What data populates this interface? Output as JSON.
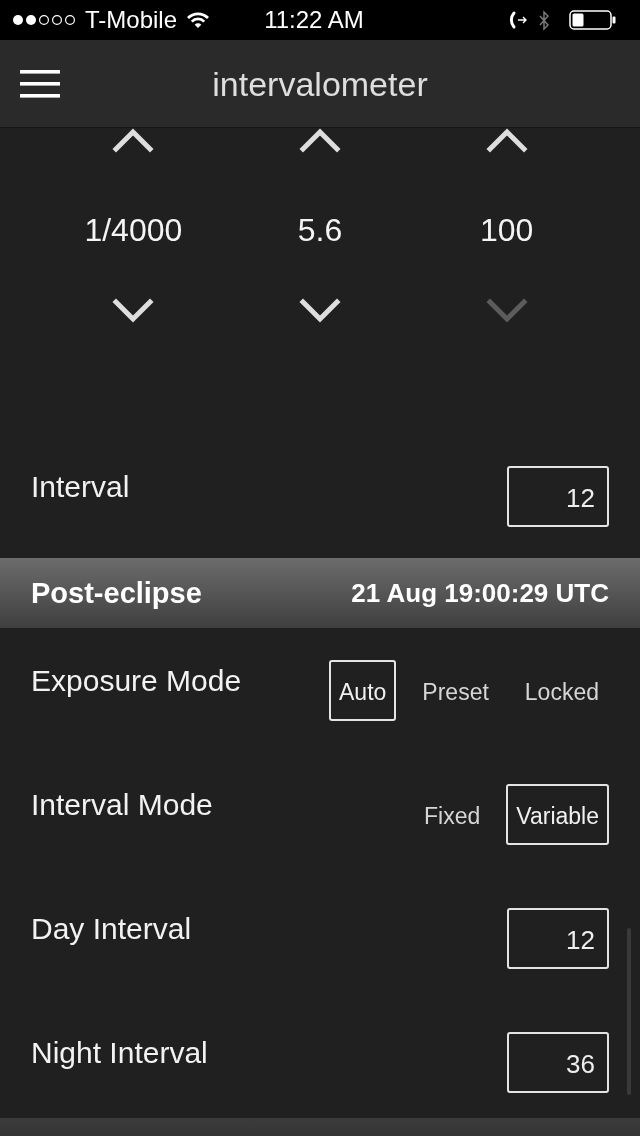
{
  "status_bar": {
    "carrier": "T-Mobile",
    "time": "11:22 AM"
  },
  "nav_bar": {
    "title": "intervalometer"
  },
  "steppers": [
    {
      "value": "1/4000",
      "up": {
        "disabled": false
      },
      "down": {
        "disabled": false
      }
    },
    {
      "value": "5.6",
      "up": {
        "disabled": false
      },
      "down": {
        "disabled": false
      }
    },
    {
      "value": "100",
      "up": {
        "disabled": false
      },
      "down": {
        "disabled": true
      }
    }
  ],
  "rows": [
    {
      "kind": "number",
      "label": "Interval",
      "value": "12"
    }
  ],
  "section": {
    "title": "Post-eclipse",
    "time": "21 Aug 19:00:29 UTC",
    "rows": [
      {
        "kind": "segmented",
        "label": "Exposure Mode",
        "options": [
          {
            "label": "Auto",
            "selected": true
          },
          {
            "label": "Preset",
            "selected": false
          },
          {
            "label": "Locked",
            "selected": false
          }
        ]
      },
      {
        "kind": "segmented",
        "label": "Interval Mode",
        "options": [
          {
            "label": "Fixed",
            "selected": false
          },
          {
            "label": "Variable",
            "selected": true
          }
        ]
      },
      {
        "kind": "number",
        "label": "Day Interval",
        "value": "12"
      },
      {
        "kind": "number",
        "label": "Night Interval",
        "value": "36"
      }
    ]
  }
}
